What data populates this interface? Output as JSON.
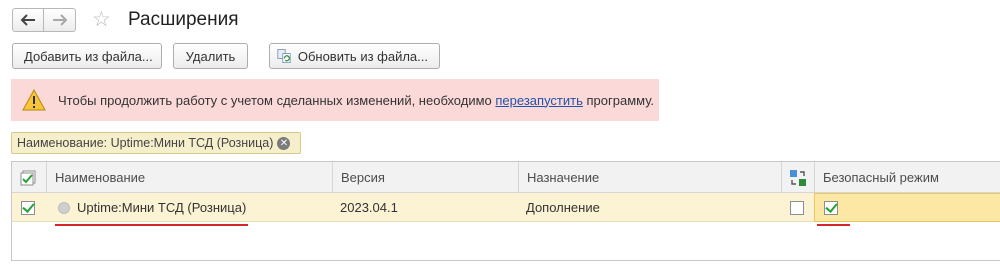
{
  "header": {
    "title": "Расширения"
  },
  "icons": {
    "back": "arrow-left-icon",
    "forward": "arrow-right-icon",
    "favorite": "star-icon",
    "update": "update-from-file-icon",
    "warning": "warning-triangle-icon",
    "clear_filter": "close-circle-icon",
    "select_all": "check-all-icon",
    "sync_column": "sync-icon",
    "status": "status-dot-icon"
  },
  "toolbar": {
    "add_label": "Добавить из файла...",
    "delete_label": "Удалить",
    "update_label": "Обновить из файла..."
  },
  "warning": {
    "text_before": "Чтобы продолжить работу с учетом сделанных изменений, необходимо ",
    "link_text": "перезапустить",
    "text_after": " программу."
  },
  "filter": {
    "label": "Наименование: Uptime:Мини ТСД (Розница)",
    "close_glyph": "✕"
  },
  "table": {
    "columns": {
      "name": "Наименование",
      "version": "Версия",
      "purpose": "Назначение",
      "safe_mode": "Безопасный режим"
    },
    "rows": [
      {
        "active": true,
        "name": "Uptime:Мини ТСД (Розница)",
        "version": "2023.04.1",
        "purpose": "Дополнение",
        "extra_flag": false,
        "safe_mode": true
      }
    ]
  },
  "colors": {
    "warning_bg": "#fcd9d9",
    "filter_bg": "#f6efcc",
    "selected_row_bg": "#fbf3d3",
    "link": "#2453a6",
    "underline_red": "#d7262b",
    "check_green": "#26a236"
  }
}
